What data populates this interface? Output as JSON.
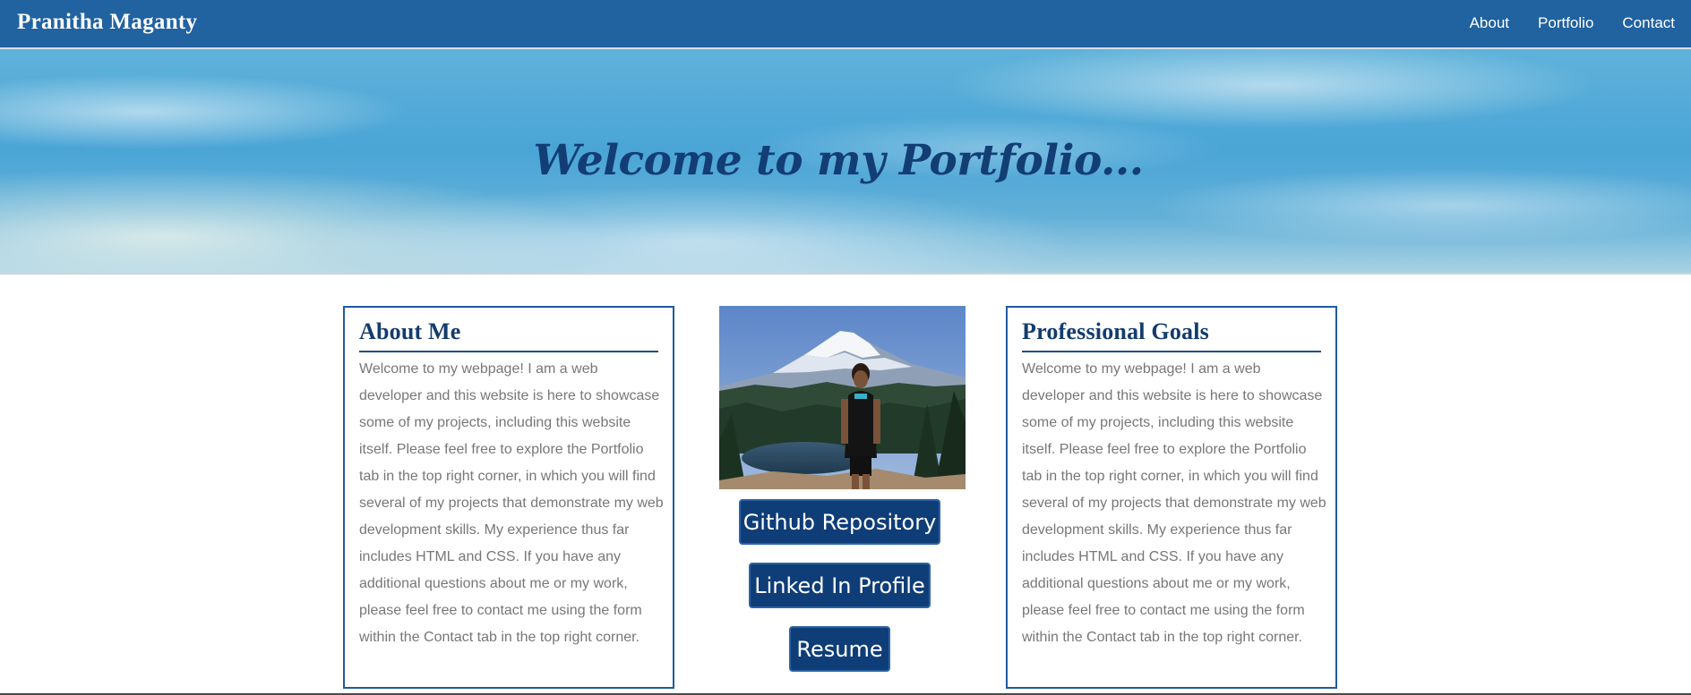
{
  "navbar": {
    "brand": "Pranitha Maganty",
    "links": [
      "About",
      "Portfolio",
      "Contact"
    ]
  },
  "hero": {
    "title": "Welcome to my Portfolio..."
  },
  "about": {
    "title": "About Me",
    "text": "Welcome to my webpage! I am a web developer and this website is here to showcase some of my projects, including this website itself. Please feel free to explore the Portfolio tab in the top right corner, in which you will find several of my projects that demonstrate my web development skills. My experience thus far includes HTML and CSS. If you have any additional questions about me or my work, please feel free to contact me using the form within the Contact tab in the top right corner."
  },
  "goals": {
    "title": "Professional Goals",
    "text": "Welcome to my webpage! I am a web developer and this website is here to showcase some of my projects, including this website itself. Please feel free to explore the Portfolio tab in the top right corner, in which you will find several of my projects that demonstrate my web development skills. My experience thus far includes HTML and CSS. If you have any additional questions about me or my work, please feel free to contact me using the form within the Contact tab in the top right corner."
  },
  "buttons": {
    "github": "Github Repository",
    "linkedin": "Linked In Profile",
    "resume": "Resume"
  },
  "colors": {
    "navbar": "#2162a0",
    "accent": "#0f3d78",
    "heading": "#133c6e",
    "body_text": "#777777"
  }
}
